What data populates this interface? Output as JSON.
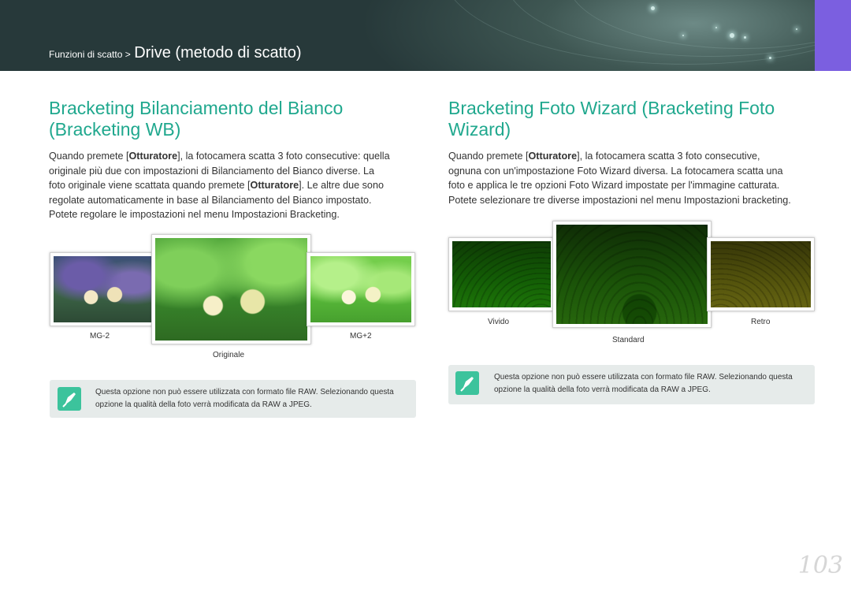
{
  "header": {
    "section": "Funzioni di scatto >",
    "title": "Drive (metodo di scatto)"
  },
  "left": {
    "heading_line1": "Bracketing Bilanciamento del Bianco",
    "heading_line2": "(Bracketing WB)",
    "para": [
      [
        "Quando premete [",
        "Otturatore",
        "], la fotocamera scatta 3 foto consecutive: quella"
      ],
      [
        "originale più due con impostazioni di Bilanciamento del Bianco diverse. La"
      ],
      [
        "foto originale viene scattata quando premete [",
        "Otturatore",
        "]. Le altre due sono"
      ],
      [
        "regolate automaticamente in base al Bilanciamento del Bianco impostato."
      ],
      [
        "Potete regolare le impostazioni nel menu Impostazioni Bracketing."
      ]
    ],
    "captions": {
      "left": "MG-2",
      "center": "Originale",
      "right": "MG+2"
    },
    "note": [
      "Questa opzione non può essere utilizzata con formato file RAW. Selezionando questa",
      "opzione la qualità della foto verrà modificata da RAW a JPEG."
    ]
  },
  "right": {
    "heading_line1": "Bracketing Foto Wizard (Bracketing Foto",
    "heading_line2": "Wizard)",
    "para": [
      [
        "Quando premete [",
        "Otturatore",
        "], la fotocamera scatta 3 foto consecutive,"
      ],
      [
        "ognuna con un'impostazione Foto Wizard diversa. La fotocamera scatta una"
      ],
      [
        "foto e applica le tre opzioni Foto Wizard impostate per l'immagine catturata."
      ],
      [
        "Potete selezionare tre diverse impostazioni nel menu Impostazioni bracketing."
      ]
    ],
    "captions": {
      "left": "Vivido",
      "center": "Standard",
      "right": "Retro"
    },
    "note": [
      "Questa opzione non può essere utilizzata con formato file RAW. Selezionando questa",
      "opzione la qualità della foto verrà modificata da RAW a JPEG."
    ]
  },
  "page_number": "103",
  "colors": {
    "accent": "#20a88e",
    "note_icon": "#3cc39c",
    "banner": "#3f5753",
    "tab": "#7b5fe0"
  },
  "icons": {
    "note": "pen-nib-icon"
  }
}
